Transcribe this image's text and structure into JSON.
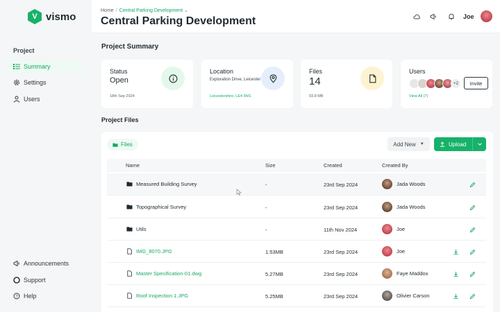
{
  "app": {
    "name": "vismo",
    "logo_letter": "V"
  },
  "sidebar": {
    "section": "Project",
    "items": [
      {
        "label": "Summary",
        "icon": "list-icon",
        "active": true
      },
      {
        "label": "Settings",
        "icon": "gear-icon"
      },
      {
        "label": "Users",
        "icon": "user-icon"
      }
    ],
    "bottom": [
      {
        "label": "Announcements",
        "icon": "megaphone-icon"
      },
      {
        "label": "Support",
        "icon": "lifebuoy-icon"
      },
      {
        "label": "Help",
        "icon": "help-icon"
      }
    ]
  },
  "header": {
    "breadcrumb": {
      "home": "Home",
      "separator": "/",
      "current": "Central Parking Development",
      "chevron": "⌄"
    },
    "title": "Central Parking Development",
    "user_name": "Joe"
  },
  "summary": {
    "title": "Project Summary",
    "status": {
      "label": "Status",
      "value": "Open",
      "date": "18th Sep 2024"
    },
    "location": {
      "label": "Location",
      "address": "Exploration Drive, Leicester",
      "postcode": "Leicestershire, LE4 5NS"
    },
    "files": {
      "label": "Files",
      "count": "14",
      "size": "93.8 MB"
    },
    "users": {
      "label": "Users",
      "more": "+2",
      "invite": "Invite",
      "view_all": "View All (7)"
    }
  },
  "project_files": {
    "title": "Project Files",
    "tab": "Files",
    "add_new": "Add New",
    "upload": "Upload",
    "columns": {
      "name": "Name",
      "size": "Size",
      "created": "Created",
      "created_by": "Created By"
    },
    "rows": [
      {
        "name": "Measured Building Survey",
        "type": "folder",
        "size": "-",
        "created": "23rd Sep 2024",
        "created_by": "Jada Woods"
      },
      {
        "name": "Topographical Survey",
        "type": "folder",
        "size": "-",
        "created": "23rd Sep 2024",
        "created_by": "Jada Woods"
      },
      {
        "name": "Utils",
        "type": "folder",
        "size": "-",
        "created": "11th Nov 2024",
        "created_by": "Joe"
      },
      {
        "name": "IMG_8070.JPG",
        "type": "file",
        "size": "1.53MB",
        "created": "23rd Sep 2024",
        "created_by": "Joe"
      },
      {
        "name": "Master Specification-01.dwg",
        "type": "file",
        "size": "5.27MB",
        "created": "23rd Sep 2024",
        "created_by": "Faye Maddox"
      },
      {
        "name": "Roof Inspection 1.JPG",
        "type": "file",
        "size": "5.25MB",
        "created": "23rd Sep 2024",
        "created_by": "Olivier Carson"
      }
    ]
  },
  "colors": {
    "accent": "#17b26a",
    "accent_text": "#17a863"
  }
}
